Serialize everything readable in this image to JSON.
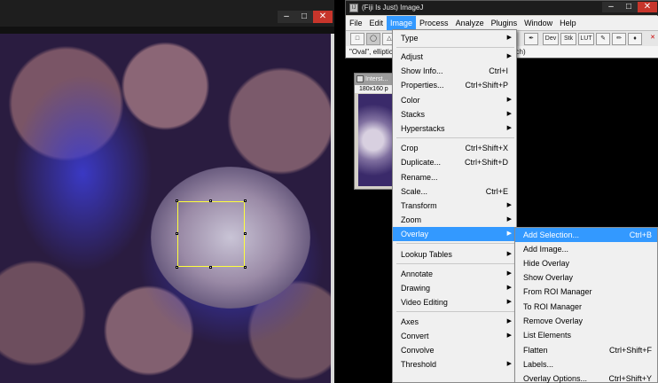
{
  "fiji_window": {
    "title": "(Fiji Is Just) ImageJ",
    "menubar": [
      "File",
      "Edit",
      "Image",
      "Process",
      "Analyze",
      "Plugins",
      "Window",
      "Help"
    ],
    "active_menu": "Image",
    "status_text": "\"Oval\", elliptical or brush selections (right click to switch)",
    "tools": [
      "rect-tool",
      "oval-tool",
      "polygon-tool",
      "freehand-tool",
      "line-tool",
      "angle-tool",
      "point-tool",
      "wand-tool",
      "text-tool",
      "magnify-tool",
      "scroll-tool",
      "color-picker-tool",
      "dev-tool",
      "stk-tool",
      "lut-tool",
      "pencil-tool",
      "brush-tool",
      "flood-fill-tool",
      "close-tool"
    ],
    "tool_labels": {
      "dev": "Dev",
      "stk": "Stk",
      "lut": "LUT"
    }
  },
  "thumbnail_window": {
    "title": "Interst...",
    "dims": "180x160 p"
  },
  "image_menu": {
    "items": [
      {
        "label": "Type",
        "submenu": true
      },
      {
        "label": "Adjust",
        "submenu": true
      },
      {
        "label": "Show Info...",
        "shortcut": "Ctrl+I"
      },
      {
        "label": "Properties...",
        "shortcut": "Ctrl+Shift+P"
      },
      {
        "label": "Color",
        "submenu": true
      },
      {
        "label": "Stacks",
        "submenu": true
      },
      {
        "label": "Hyperstacks",
        "submenu": true
      },
      {
        "label": "Crop",
        "shortcut": "Ctrl+Shift+X"
      },
      {
        "label": "Duplicate...",
        "shortcut": "Ctrl+Shift+D"
      },
      {
        "label": "Rename..."
      },
      {
        "label": "Scale...",
        "shortcut": "Ctrl+E"
      },
      {
        "label": "Transform",
        "submenu": true
      },
      {
        "label": "Zoom",
        "submenu": true
      },
      {
        "label": "Overlay",
        "submenu": true,
        "highlight": true
      },
      {
        "label": "Lookup Tables",
        "submenu": true
      },
      {
        "label": "Annotate",
        "submenu": true
      },
      {
        "label": "Drawing",
        "submenu": true
      },
      {
        "label": "Video Editing",
        "submenu": true
      },
      {
        "label": "Axes",
        "submenu": true
      },
      {
        "label": "Convert",
        "submenu": true
      },
      {
        "label": "Convolve"
      },
      {
        "label": "Threshold",
        "submenu": true
      }
    ]
  },
  "overlay_menu": {
    "items": [
      {
        "label": "Add Selection...",
        "shortcut": "Ctrl+B",
        "highlight": true
      },
      {
        "label": "Add Image..."
      },
      {
        "label": "Hide Overlay"
      },
      {
        "label": "Show Overlay"
      },
      {
        "label": "From ROI Manager"
      },
      {
        "label": "To ROI Manager"
      },
      {
        "label": "Remove Overlay"
      },
      {
        "label": "List Elements"
      },
      {
        "label": "Flatten",
        "shortcut": "Ctrl+Shift+F"
      },
      {
        "label": "Labels..."
      },
      {
        "label": "Overlay Options...",
        "shortcut": "Ctrl+Shift+Y"
      }
    ]
  },
  "colors": {
    "menu_highlight": "#3399ff",
    "roi_color": "#ffff3c",
    "close_button": "#c7352b"
  }
}
